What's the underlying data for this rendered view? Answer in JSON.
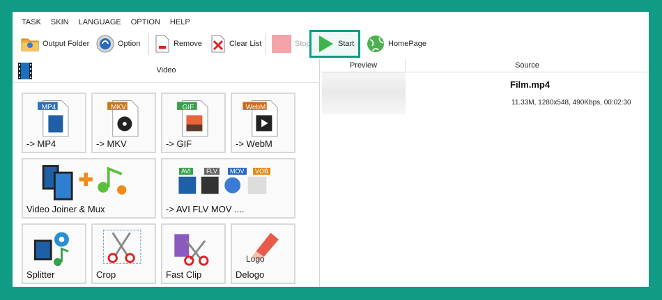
{
  "menu": [
    "TASK",
    "SKIN",
    "LANGUAGE",
    "OPTION",
    "HELP"
  ],
  "toolbar": {
    "output_folder": "Output Folder",
    "option": "Option",
    "remove": "Remove",
    "clear_list": "Clear List",
    "stop": "Stop",
    "start": "Start",
    "homepage": "HomePage"
  },
  "left_panel": {
    "title": "Video",
    "tiles": [
      {
        "label": "-> MP4",
        "badge": "MP4"
      },
      {
        "label": "-> MKV",
        "badge": "MKV"
      },
      {
        "label": "-> GIF",
        "badge": "GIF"
      },
      {
        "label": "-> WebM",
        "badge": "WebM"
      },
      {
        "label": "Video Joiner & Mux"
      },
      {
        "label": "-> AVI FLV MOV ....",
        "badges": [
          "AVI",
          "FLV",
          "MOV",
          "VOB"
        ]
      },
      {
        "label": "Splitter"
      },
      {
        "label": "Crop"
      },
      {
        "label": "Fast Clip"
      },
      {
        "label": "Delogo",
        "logo_text": "Logo"
      }
    ]
  },
  "file_list": {
    "columns": [
      "Preview",
      "Source"
    ],
    "files": [
      {
        "name": "Film.mp4",
        "info": "11.33M, 1280x548, 490Kbps, 00:02:30"
      }
    ]
  },
  "colors": {
    "accent": "#0f9b85"
  }
}
